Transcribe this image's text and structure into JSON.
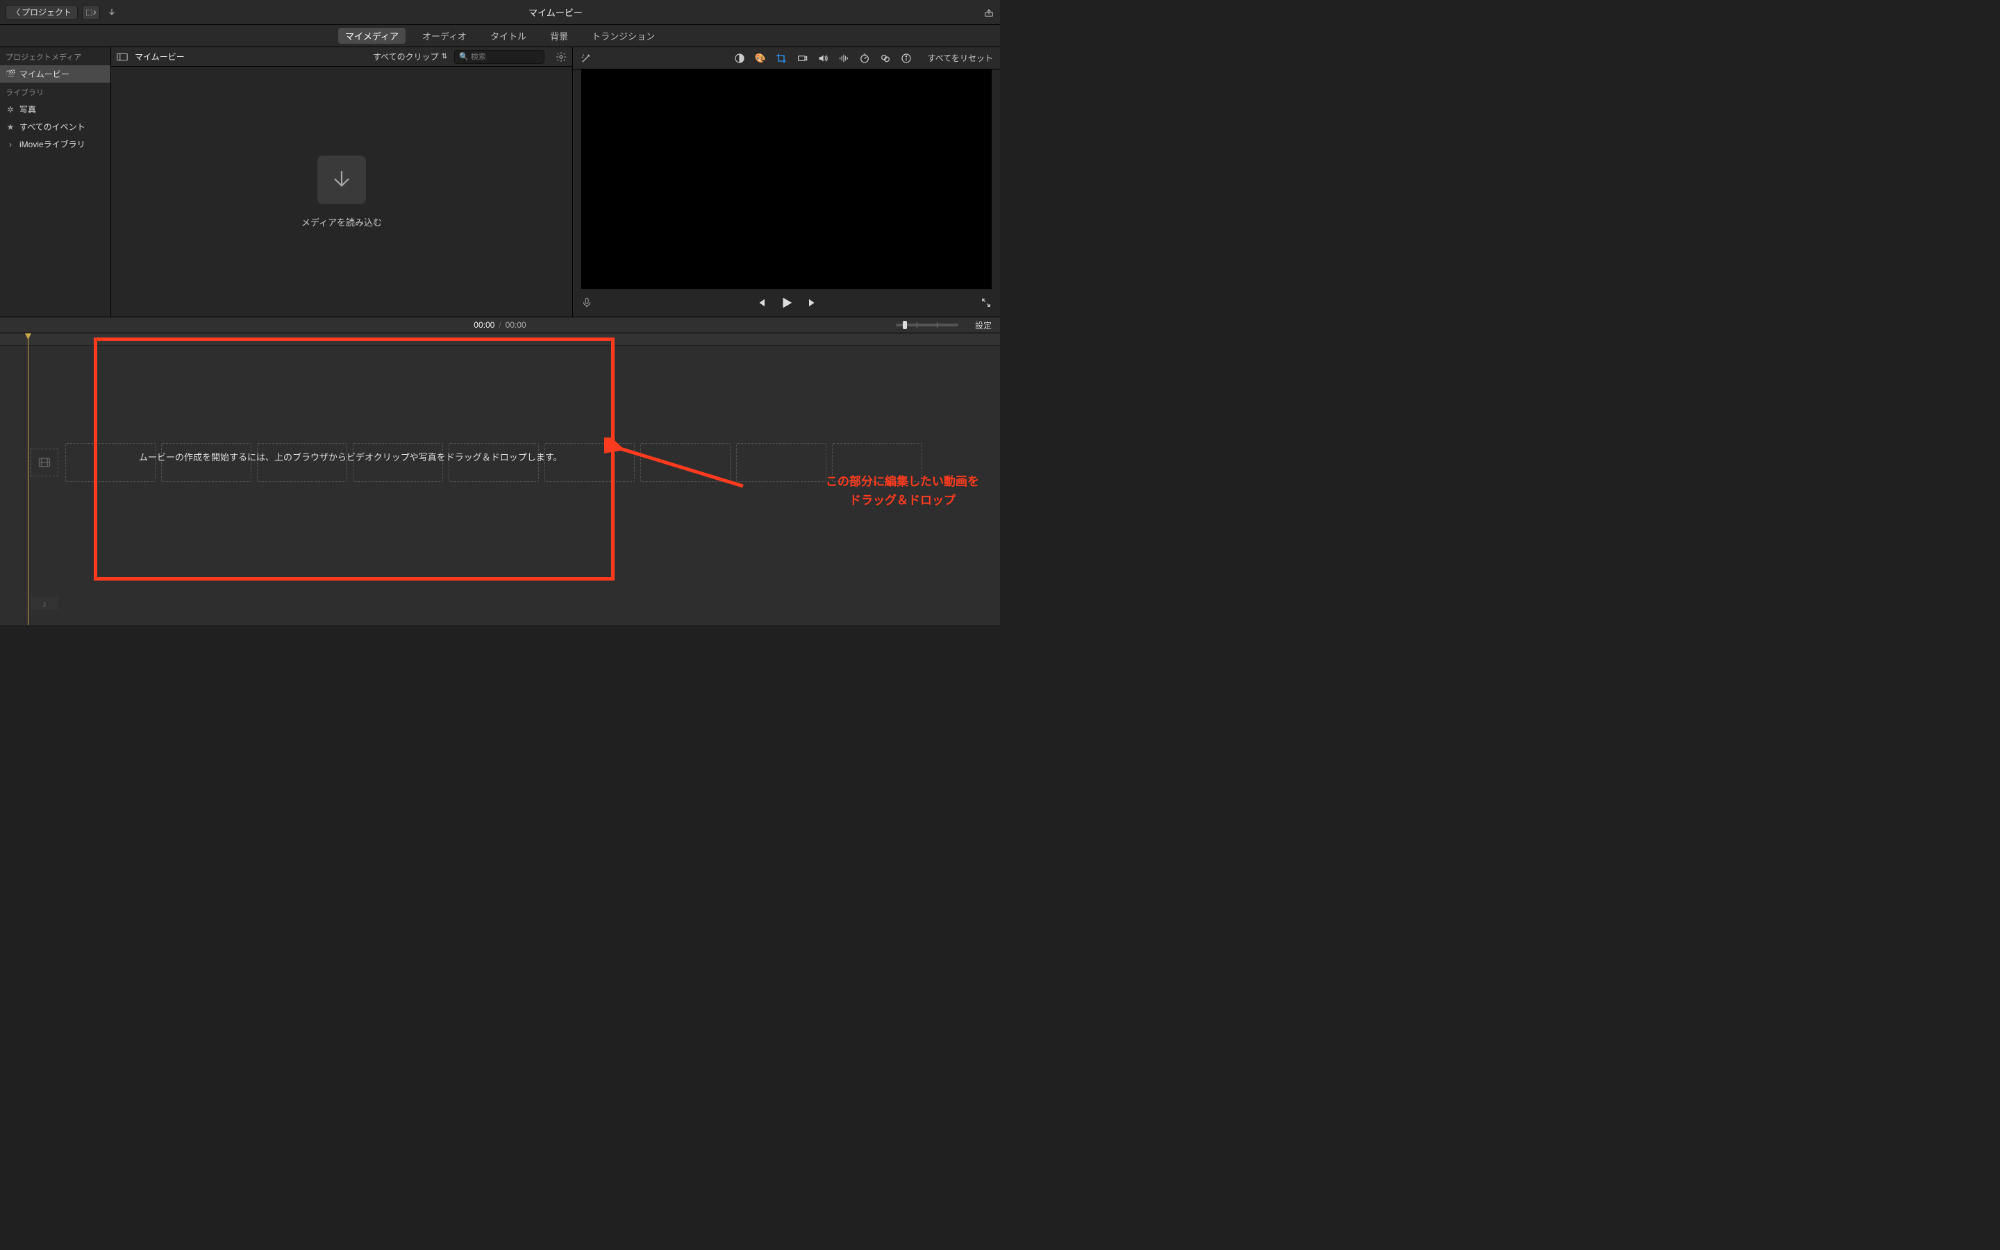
{
  "topbar": {
    "back_label": "プロジェクト",
    "title": "マイムービー"
  },
  "tabs": {
    "my_media": "マイメディア",
    "audio": "オーディオ",
    "titles": "タイトル",
    "backgrounds": "背景",
    "transitions": "トランジション"
  },
  "sidebar": {
    "project_media_header": "プロジェクトメディア",
    "project_item": "マイムービー",
    "library_header": "ライブラリ",
    "photos": "写真",
    "all_events": "すべてのイベント",
    "imovie_library": "iMovieライブラリ"
  },
  "browser": {
    "title": "マイムービー",
    "filter_label": "すべてのクリップ",
    "search_placeholder": "検索",
    "import_label": "メディアを読み込む"
  },
  "viewer": {
    "reset_label": "すべてをリセット"
  },
  "timecode": {
    "current": "00:00",
    "total": "00:00",
    "settings_label": "設定"
  },
  "timeline": {
    "hint": "ムービーの作成を開始するには、上のブラウザからビデオクリップや写真をドラッグ＆ドロップします。"
  },
  "annotation": {
    "line1": "この部分に編集したい動画を",
    "line2": "ドラッグ＆ドロップ"
  }
}
